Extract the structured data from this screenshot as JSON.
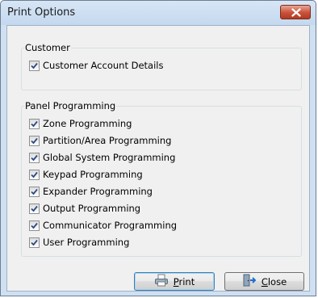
{
  "window": {
    "title": "Print Options"
  },
  "title_bar": {
    "close_icon": "close-icon"
  },
  "groups": {
    "customer": {
      "title": "Customer",
      "items": [
        {
          "label": "Customer Account Details",
          "checked": true
        }
      ]
    },
    "panel": {
      "title": "Panel Programming",
      "items": [
        {
          "label": "Zone Programming",
          "checked": true
        },
        {
          "label": "Partition/Area Programming",
          "checked": true
        },
        {
          "label": "Global System Programming",
          "checked": true
        },
        {
          "label": "Keypad Programming",
          "checked": true
        },
        {
          "label": "Expander Programming",
          "checked": true
        },
        {
          "label": "Output Programming",
          "checked": true
        },
        {
          "label": "Communicator Programming",
          "checked": true
        },
        {
          "label": "User Programming",
          "checked": true
        }
      ]
    }
  },
  "buttons": {
    "print": {
      "accel": "P",
      "rest": "rint",
      "icon": "printer-icon"
    },
    "close": {
      "accel": "C",
      "rest": "lose",
      "icon": "exit-door-icon"
    }
  },
  "colors": {
    "accent": "#3c7fb1",
    "close_red": "#c8513a"
  }
}
